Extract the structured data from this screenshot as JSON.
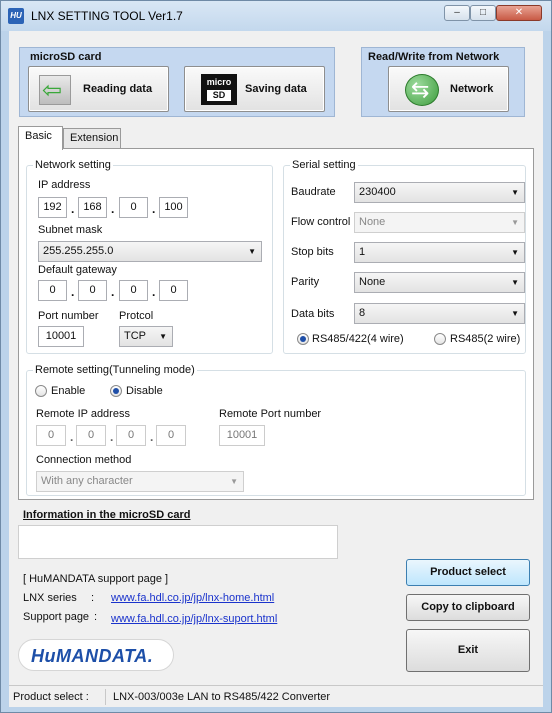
{
  "window": {
    "title": "LNX SETTING TOOL Ver1.7",
    "app_icon": "HU"
  },
  "controls": {
    "minimize": "–",
    "maximize": "□",
    "close": "✕"
  },
  "sd_panel": {
    "title": "microSD card",
    "reading_label": "Reading data",
    "saving_label": "Saving data",
    "sd_icon_top": "micro",
    "sd_icon_bottom": "SD"
  },
  "net_panel": {
    "title": "Read/Write from Network",
    "network_label": "Network"
  },
  "tabs": [
    {
      "label": "Basic"
    },
    {
      "label": "Extension"
    }
  ],
  "network_setting": {
    "legend": "Network setting",
    "ip_label": "IP address",
    "ip": [
      "192",
      "168",
      "0",
      "100"
    ],
    "mask_label": "Subnet mask",
    "mask": "255.255.255.0",
    "gateway_label": "Default gateway",
    "gateway": [
      "0",
      "0",
      "0",
      "0"
    ],
    "port_label": "Port number",
    "port": "10001",
    "protocol_label": "Protcol",
    "protocol": "TCP"
  },
  "serial_setting": {
    "legend": "Serial setting",
    "baud_label": "Baudrate",
    "baud": "230400",
    "flow_label": "Flow control",
    "flow": "None",
    "stop_label": "Stop bits",
    "stop": "1",
    "parity_label": "Parity",
    "parity": "None",
    "data_label": "Data bits",
    "data": "8",
    "rs485_4": "RS485/422(4 wire)",
    "rs485_2": "RS485(2 wire)"
  },
  "remote_setting": {
    "legend": "Remote setting(Tunneling mode)",
    "enable": "Enable",
    "disable": "Disable",
    "ip_label": "Remote IP address",
    "ip": [
      "0",
      "0",
      "0",
      "0"
    ],
    "port_label": "Remote Port number",
    "port": "10001",
    "method_label": "Connection method",
    "method": "With any character"
  },
  "info": {
    "title": "Information in the microSD card",
    "support_heading": "[ HuMANDATA support page ]",
    "series_label": "LNX series",
    "series_sep": ":",
    "series_url": "www.fa.hdl.co.jp/jp/lnx-home.html",
    "support_label": "Support page",
    "support_sep": ":",
    "support_url": "www.fa.hdl.co.jp/jp/lnx-suport.html"
  },
  "buttons": {
    "product_select": "Product select",
    "copy": "Copy to clipboard",
    "exit": "Exit"
  },
  "logo": "HuMANDATA.",
  "status": {
    "label": "Product select :",
    "value": "LNX-003/003e LAN to RS485/422 Converter"
  },
  "colors": {
    "panel": "#c5d8f0",
    "link": "#1a33cc",
    "window_frame": "#bcd3ea"
  }
}
